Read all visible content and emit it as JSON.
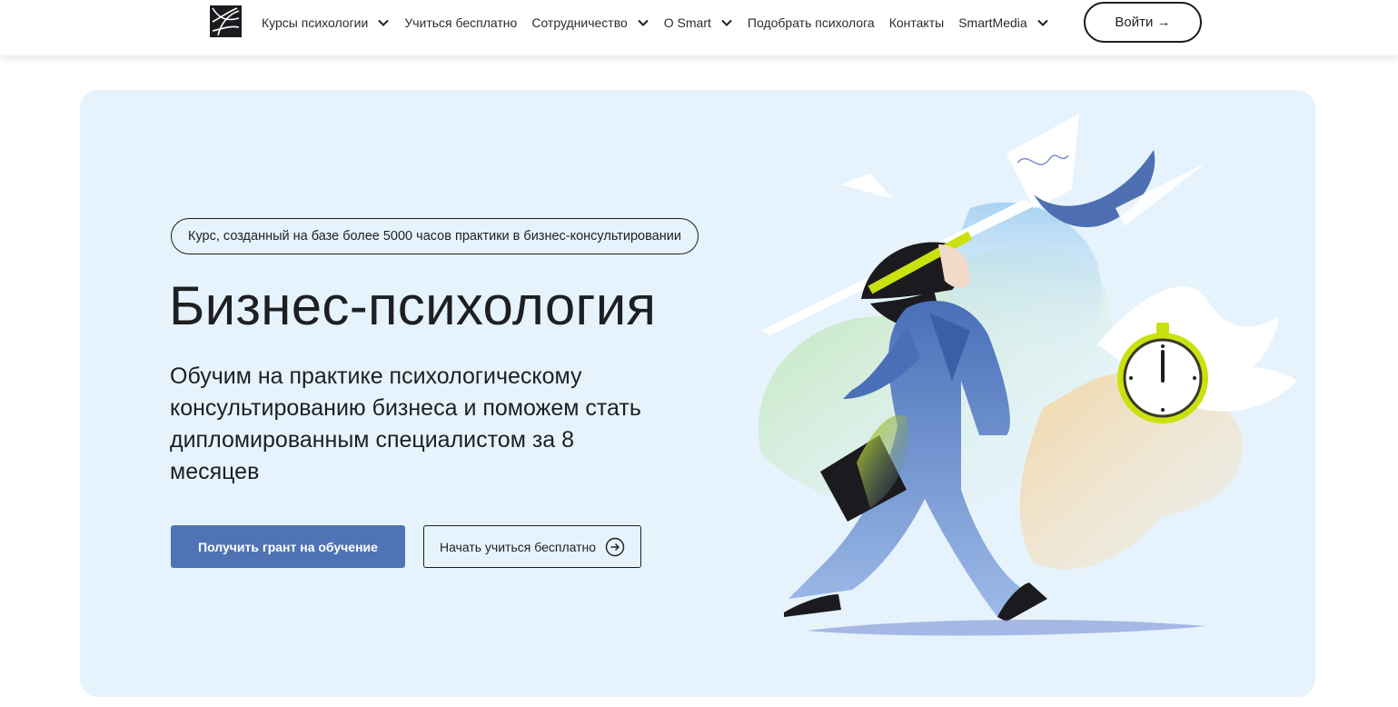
{
  "header": {
    "nav": [
      {
        "label": "Курсы психологии",
        "dropdown": true
      },
      {
        "label": "Учиться бесплатно",
        "dropdown": false
      },
      {
        "label": "Сотрудничество",
        "dropdown": true
      },
      {
        "label": "О Smart",
        "dropdown": true
      },
      {
        "label": "Подобрать психолога",
        "dropdown": false
      },
      {
        "label": "Контакты",
        "dropdown": false
      },
      {
        "label": "SmartMedia",
        "dropdown": true
      }
    ],
    "login_label": "Войти →"
  },
  "hero": {
    "badge": "Курс, созданный на базе более 5000 часов практики в бизнес-консультировании",
    "title": "Бизнес-психология",
    "subtitle": "Обучим на практике психологическому консультированию бизнеса и поможем стать дипломированным специалистом за 8 месяцев",
    "primary_button": "Получить грант на обучение",
    "secondary_button": "Начать учиться бесплатно"
  },
  "colors": {
    "accent": "#5073b5",
    "hero_bg": "#e6f3fc",
    "text": "#1e1f22",
    "lime": "#c9e20f"
  },
  "icons": [
    "logo-mark",
    "chevron-down-icon",
    "arrow-right-circle-icon"
  ]
}
